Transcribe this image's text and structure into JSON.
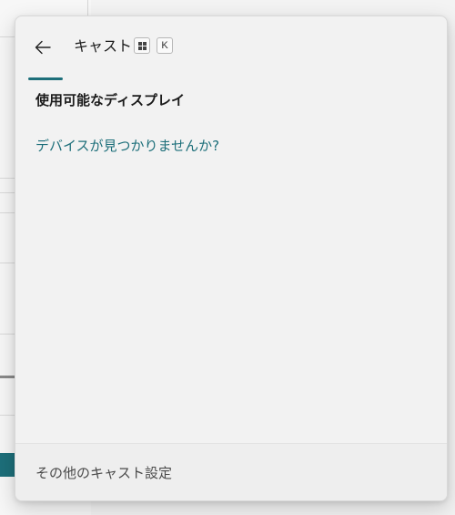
{
  "flyout": {
    "title": "キャスト",
    "shortcut_keys": [
      "win",
      "K"
    ],
    "section_title": "使用可能なディスプレイ",
    "help_link": "デバイスが見つかりませんか?",
    "footer_link": "その他のキャスト設定"
  },
  "icons": {
    "back": "back-arrow-icon",
    "windows_key": "windows-logo-icon"
  },
  "colors": {
    "accent": "#1d6f7a",
    "panel_bg": "#f2f2f2",
    "text_primary": "#1b1b1b",
    "text_secondary": "#4a4a4a"
  }
}
